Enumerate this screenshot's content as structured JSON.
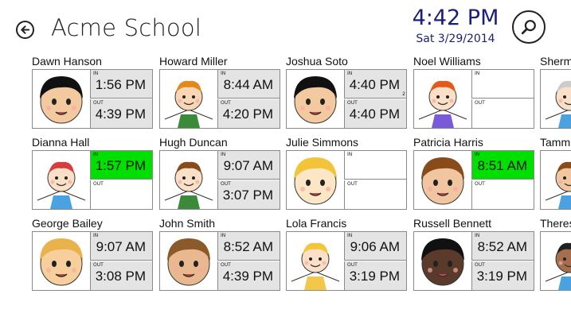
{
  "header": {
    "school_name": "Acme School",
    "time": "4:42 PM",
    "date": "Sat 3/29/2014",
    "back_icon": "back-arrow-icon",
    "search_icon": "search-icon"
  },
  "labels": {
    "in": "IN",
    "out": "OUT"
  },
  "colors": {
    "accent": "#1b1f7a",
    "checked_in_highlight": "#00e000",
    "cell_filled": "#e4e4e4"
  },
  "students": [
    {
      "name": "Dawn Hanson",
      "in": "1:56 PM",
      "out": "4:39 PM",
      "in_note": "",
      "highlight": false
    },
    {
      "name": "Howard Miller",
      "in": "8:44 AM",
      "out": "4:20 PM",
      "in_note": "",
      "highlight": false
    },
    {
      "name": "Joshua Soto",
      "in": "4:40 PM",
      "out": "4:40 PM",
      "in_note": "2",
      "highlight": false
    },
    {
      "name": "Noel Williams",
      "in": "",
      "out": "",
      "in_note": "",
      "highlight": false
    },
    {
      "name": "Sherm",
      "in": "",
      "out": "",
      "in_note": "",
      "highlight": false
    },
    {
      "name": "Dianna Hall",
      "in": "1:57 PM",
      "out": "",
      "in_note": "",
      "highlight": true
    },
    {
      "name": "Hugh Duncan",
      "in": "9:07 AM",
      "out": "3:07 PM",
      "in_note": "",
      "highlight": false
    },
    {
      "name": "Julie Simmons",
      "in": "",
      "out": "",
      "in_note": "",
      "highlight": false
    },
    {
      "name": "Patricia Harris",
      "in": "8:51 AM",
      "out": "",
      "in_note": "",
      "highlight": true
    },
    {
      "name": "Tamm",
      "in": "",
      "out": "",
      "in_note": "",
      "highlight": false
    },
    {
      "name": "George Bailey",
      "in": "9:07 AM",
      "out": "3:08 PM",
      "in_note": "",
      "highlight": false
    },
    {
      "name": "John Smith",
      "in": "8:52 AM",
      "out": "4:39 PM",
      "in_note": "",
      "highlight": false
    },
    {
      "name": "Lola Francis",
      "in": "9:06 AM",
      "out": "3:19 PM",
      "in_note": "",
      "highlight": false
    },
    {
      "name": "Russell Bennett",
      "in": "8:52 AM",
      "out": "3:19 PM",
      "in_note": "",
      "highlight": false
    },
    {
      "name": "Theres",
      "in": "",
      "out": "",
      "in_note": "",
      "highlight": false
    }
  ]
}
